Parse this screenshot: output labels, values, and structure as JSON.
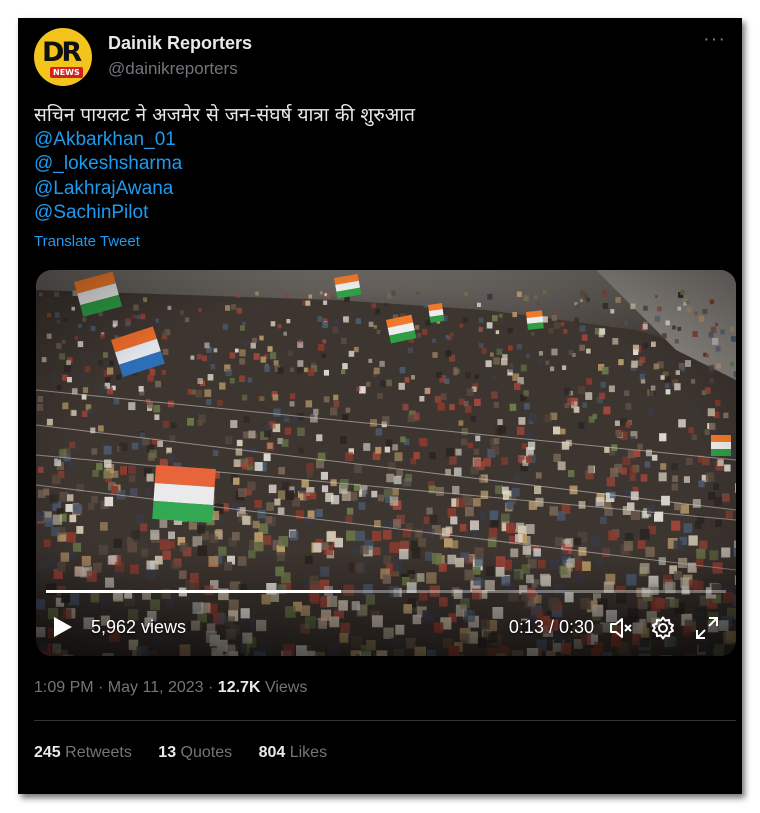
{
  "author": {
    "name": "Dainik Reporters",
    "handle": "@dainikreporters",
    "avatar_text": "DR",
    "avatar_subtext": "NEWS",
    "more_icon": "more-horizontal-icon"
  },
  "tweet": {
    "text": "सचिन पायलट ने अजमेर से जन-संघर्ष यात्रा की शुरुआत",
    "mentions": [
      "@Akbarkhan_01",
      "@_lokeshsharma",
      "@LakhrajAwana",
      "@SachinPilot"
    ],
    "translate_label": "Translate Tweet"
  },
  "video": {
    "views": "5,962 views",
    "time": "0:13 / 0:30",
    "progress": 0.4333,
    "icons": [
      "play-icon",
      "mute-icon",
      "settings-icon",
      "fullscreen-icon"
    ]
  },
  "meta": {
    "timestamp": "1:09 PM · May 11, 2023 · ",
    "views_count": "12.7K",
    "views_label": " Views"
  },
  "stats": {
    "retweets_count": "245",
    "retweets_label": " Retweets",
    "quotes_count": "13",
    "quotes_label": " Quotes",
    "likes_count": "804",
    "likes_label": " Likes"
  },
  "colors": {
    "background": "#000000",
    "text": "#e7e9ea",
    "secondary": "#71767b",
    "link": "#1d9bf0",
    "avatar": "#f3c41b"
  }
}
